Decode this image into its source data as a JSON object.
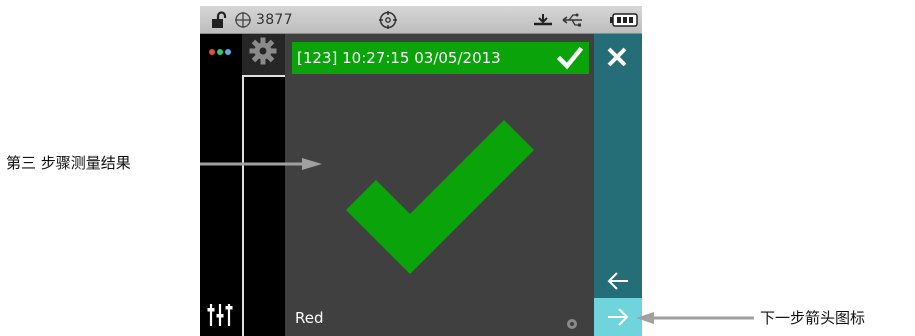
{
  "status_bar": {
    "count": "3877",
    "icons": [
      "unlock-icon",
      "crosshair-icon",
      "target-icon",
      "antenna-icon",
      "usb-icon",
      "battery-icon"
    ]
  },
  "sidebar": {
    "icons": [
      "dots-menu-icon",
      "gear-icon",
      "sliders-icon"
    ],
    "dot_colors": [
      "#e74c3c",
      "#2ecc71",
      "#5dade2"
    ]
  },
  "header": {
    "text": "[123] 10:27:15 03/05/2013",
    "icon": "check-icon",
    "color": "#0aa30a"
  },
  "main": {
    "result_icon": "large-check-icon",
    "result_color": "#0aa30a",
    "color_name": "Red"
  },
  "right_bar": {
    "close_icon": "close-icon",
    "back_icon": "arrow-left-icon",
    "next_icon": "arrow-right-icon",
    "color": "#256e78",
    "next_color": "#6fd4dc"
  },
  "annotations": {
    "left_label": "第三 步骤测量结果",
    "right_label": "下一步箭头图标"
  }
}
